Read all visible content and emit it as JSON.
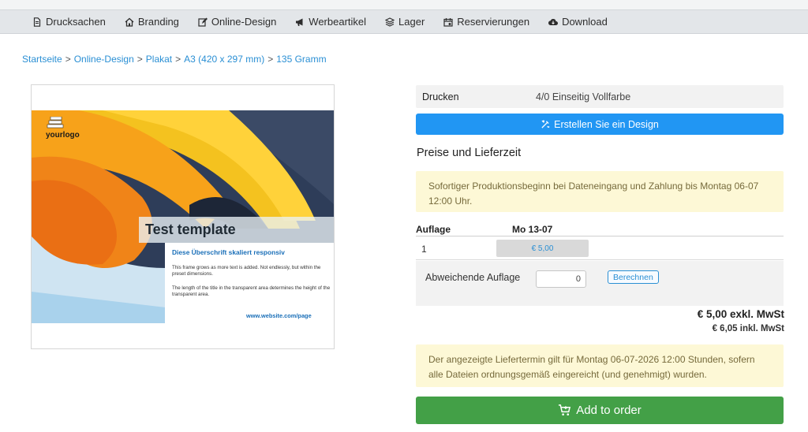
{
  "nav": {
    "items": [
      {
        "label": "Drucksachen",
        "icon": "document-icon"
      },
      {
        "label": "Branding",
        "icon": "home-icon"
      },
      {
        "label": "Online-Design",
        "icon": "edit-icon"
      },
      {
        "label": "Werbeartikel",
        "icon": "megaphone-icon"
      },
      {
        "label": "Lager",
        "icon": "layers-icon"
      },
      {
        "label": "Reservierungen",
        "icon": "calendar-icon"
      },
      {
        "label": "Download",
        "icon": "cloud-download-icon"
      }
    ]
  },
  "breadcrumb": {
    "items": [
      "Startseite",
      "Online-Design",
      "Plakat",
      "A3 (420 x 297 mm)",
      "135 Gramm"
    ],
    "separator": ">"
  },
  "preview": {
    "logo_text": "yourlogo",
    "title": "Test template",
    "subtitle": "Diese Überschrift skaliert responsiv",
    "paragraph1": "This frame grows as more text is added. Not endlessly, but within the preset dimensions.",
    "paragraph2": "The length of the title in the transparent area determines the height of the transparent area.",
    "url": "www.website.com/page"
  },
  "product": {
    "print_label": "Drucken",
    "print_value": "4/0 Einseitig Vollfarbe",
    "design_button": "Erstellen Sie ein Design"
  },
  "pricing": {
    "heading": "Preise und Lieferzeit",
    "notice_production": "Sofortiger Produktionsbeginn bei Dateneingang und Zahlung bis Montag 06-07 12:00 Uhr.",
    "col_quantity": "Auflage",
    "col_date": "Mo 13-07",
    "rows": [
      {
        "quantity": "1",
        "price": "€ 5,00"
      }
    ],
    "custom_label": "Abweichende Auflage",
    "custom_value": "0",
    "calculate_button": "Berechnen",
    "total_excl": "€ 5,00 exkl. MwSt",
    "total_incl": "€ 6,05 inkl. MwSt",
    "notice_delivery": "Der angezeigte Liefertermin gilt für Montag 06-07-2026 12:00 Stunden, sofern alle Dateien ordnungsgemäß eingereicht (und genehmigt) wurden.",
    "order_button": "Add to order"
  },
  "colors": {
    "primary_blue": "#2196f3",
    "order_green": "#43a047",
    "notice_bg": "#fdf8d6",
    "link_blue": "#2a8fd4"
  }
}
